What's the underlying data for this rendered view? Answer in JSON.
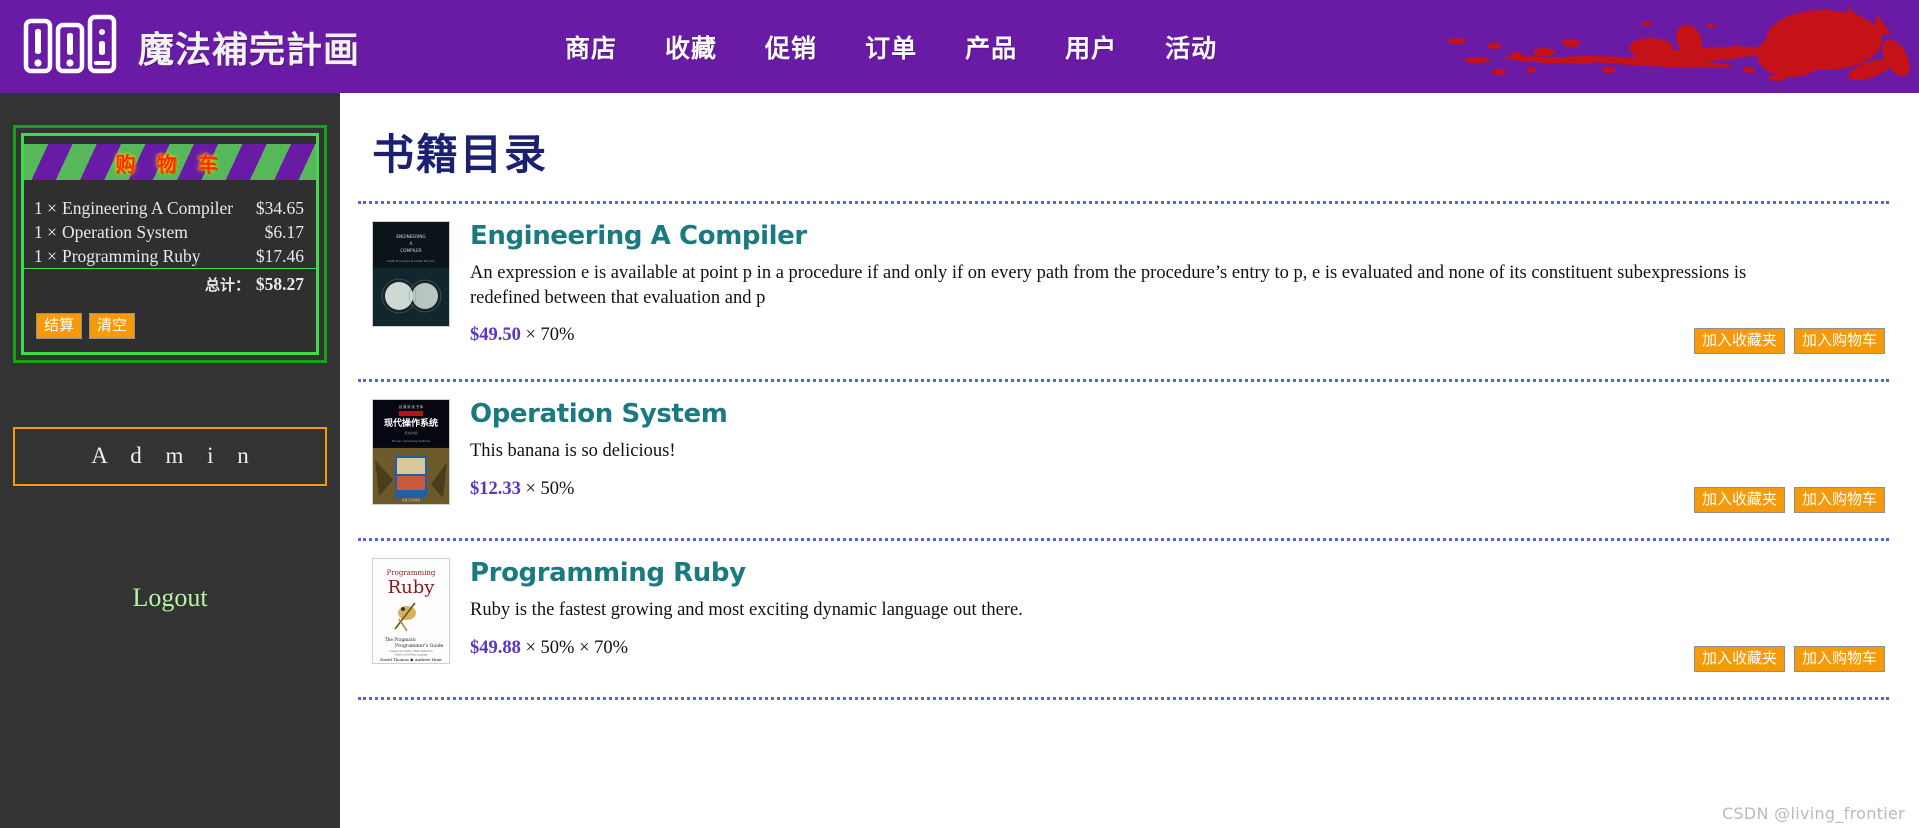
{
  "header": {
    "logo_icon": "three-books-icon",
    "brand_title": "魔法補完計画",
    "decoration_icon": "red-splatter-decoration",
    "nav": [
      {
        "label": "商店",
        "name": "shop"
      },
      {
        "label": "收藏",
        "name": "favorites"
      },
      {
        "label": "促销",
        "name": "promotions"
      },
      {
        "label": "订单",
        "name": "orders"
      },
      {
        "label": "产品",
        "name": "products"
      },
      {
        "label": "用户",
        "name": "users"
      },
      {
        "label": "活动",
        "name": "activities"
      }
    ]
  },
  "sidebar": {
    "cart": {
      "title": "购 物 车",
      "items": [
        {
          "qty": "1 ×",
          "name": "Engineering A Compiler",
          "price": "$34.65"
        },
        {
          "qty": "1 ×",
          "name": "Operation System",
          "price": "$6.17"
        },
        {
          "qty": "1 ×",
          "name": "Programming Ruby",
          "price": "$17.46"
        }
      ],
      "total_label": "总计：",
      "total_value": "$58.27",
      "checkout_label": "结算",
      "clear_label": "清空"
    },
    "admin_label": "A d m i n",
    "logout_label": "Logout"
  },
  "main": {
    "title": "书籍目录",
    "books": [
      {
        "title": "Engineering A Compiler",
        "description": "An expression e is available at point p in a procedure if and only if on every path from the procedure’s entry to p, e is evaluated and none of its constituent subexpressions is redefined between that evaluation and p",
        "price": "$49.50",
        "discounts": "× 70%",
        "cover_icon": "book-cover-engineering-a-compiler",
        "add_favorite_label": "加入收藏夹",
        "add_cart_label": "加入购物车"
      },
      {
        "title": "Operation System",
        "description": "This banana is so delicious!",
        "price": "$12.33",
        "discounts": "× 50%",
        "cover_icon": "book-cover-operation-system",
        "add_favorite_label": "加入收藏夹",
        "add_cart_label": "加入购物车"
      },
      {
        "title": "Programming Ruby",
        "description": "Ruby is the fastest growing and most exciting dynamic language out there.",
        "price": "$49.88",
        "discounts": "× 50% × 70%",
        "cover_icon": "book-cover-programming-ruby",
        "add_favorite_label": "加入收藏夹",
        "add_cart_label": "加入购物车"
      }
    ],
    "watermark": "CSDN @living_frontier"
  },
  "colors": {
    "brand_purple": "#6a1ba5",
    "sidebar_dark": "#333333",
    "cart_green": "#3ddc48",
    "accent_orange": "#f79a09",
    "title_navy": "#1b2070",
    "book_teal": "#1a7a7f",
    "price_purple": "#5b32c8",
    "splash_red": "#c41218"
  }
}
